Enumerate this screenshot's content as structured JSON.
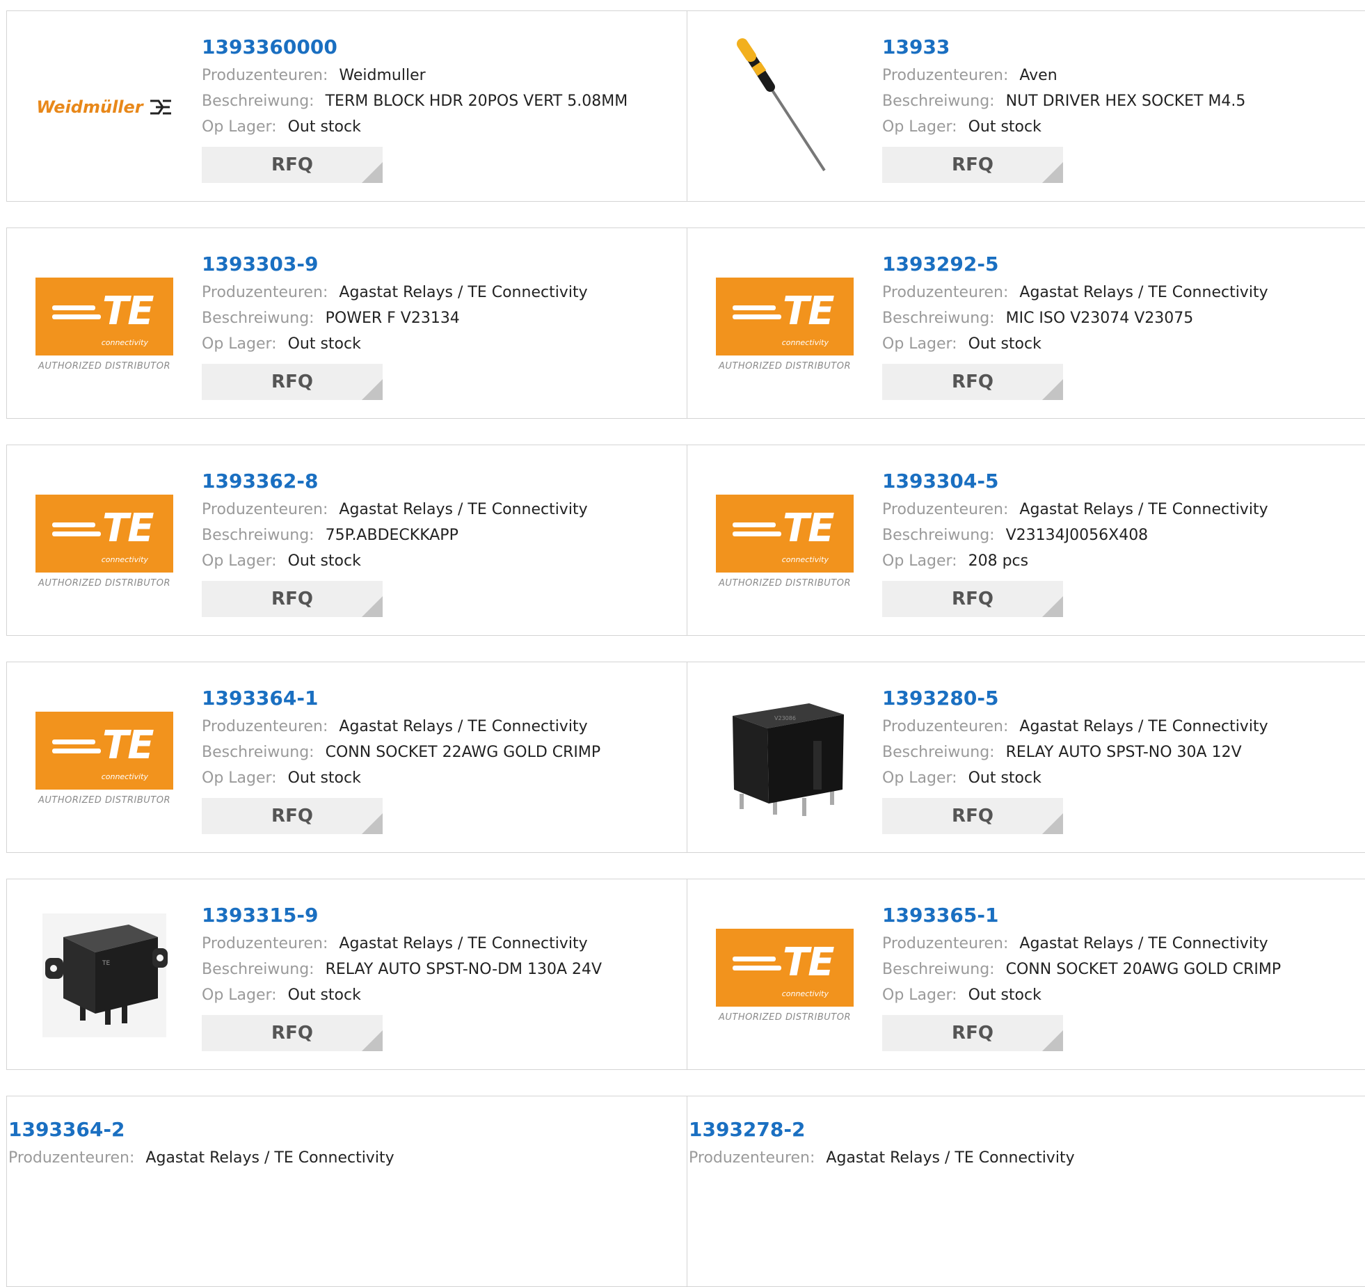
{
  "labels": {
    "manufacturer": "Produzenteuren:",
    "description": "Beschreiwung:",
    "stock": "Op Lager:",
    "rfq": "RFQ"
  },
  "brand": {
    "te_sub": "connectivity",
    "te_authorized": "AUTHORIZED DISTRIBUTOR",
    "weidmuller": "Weidmüller"
  },
  "colors": {
    "link": "#1a6fc1",
    "te_orange": "#f2931d",
    "weidmuller_orange": "#e8881a",
    "rfq_bg": "#efefef"
  },
  "products": [
    {
      "part": "1393360000",
      "manufacturer": "Weidmuller",
      "description": "TERM BLOCK HDR 20POS VERT 5.08MM",
      "stock": "Out stock",
      "image": "weidmuller-logo"
    },
    {
      "part": "13933",
      "manufacturer": "Aven",
      "description": "NUT DRIVER HEX SOCKET M4.5",
      "stock": "Out stock",
      "image": "screwdriver"
    },
    {
      "part": "1393303-9",
      "manufacturer": "Agastat Relays / TE Connectivity",
      "description": "POWER F V23134",
      "stock": "Out stock",
      "image": "te-logo"
    },
    {
      "part": "1393292-5",
      "manufacturer": "Agastat Relays / TE Connectivity",
      "description": "MIC ISO V23074 V23075",
      "stock": "Out stock",
      "image": "te-logo"
    },
    {
      "part": "1393362-8",
      "manufacturer": "Agastat Relays / TE Connectivity",
      "description": "75P.ABDECKKAPP",
      "stock": "Out stock",
      "image": "te-logo"
    },
    {
      "part": "1393304-5",
      "manufacturer": "Agastat Relays / TE Connectivity",
      "description": "V23134J0056X408",
      "stock": "208 pcs",
      "image": "te-logo"
    },
    {
      "part": "1393364-1",
      "manufacturer": "Agastat Relays / TE Connectivity",
      "description": "CONN SOCKET 22AWG GOLD CRIMP",
      "stock": "Out stock",
      "image": "te-logo"
    },
    {
      "part": "1393280-5",
      "manufacturer": "Agastat Relays / TE Connectivity",
      "description": "RELAY AUTO SPST-NO 30A 12V",
      "stock": "Out stock",
      "image": "relay-cube"
    },
    {
      "part": "1393315-9",
      "manufacturer": "Agastat Relays / TE Connectivity",
      "description": "RELAY AUTO SPST-NO-DM 130A 24V",
      "stock": "Out stock",
      "image": "relay-flange"
    },
    {
      "part": "1393365-1",
      "manufacturer": "Agastat Relays / TE Connectivity",
      "description": "CONN SOCKET 20AWG GOLD CRIMP",
      "stock": "Out stock",
      "image": "te-logo"
    },
    {
      "part": "1393364-2",
      "manufacturer": "Agastat Relays / TE Connectivity",
      "description": "",
      "stock": "",
      "image": ""
    },
    {
      "part": "1393278-2",
      "manufacturer": "Agastat Relays / TE Connectivity",
      "description": "",
      "stock": "",
      "image": ""
    }
  ]
}
